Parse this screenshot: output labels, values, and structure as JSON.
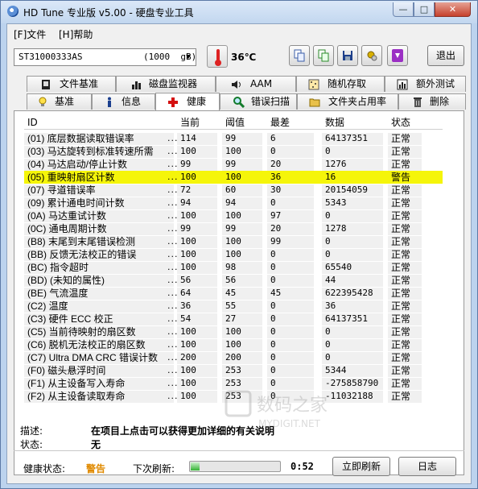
{
  "window": {
    "title": "HD Tune 专业版 v5.00 - 硬盘专业工具"
  },
  "menu": {
    "file": "[F]文件",
    "help": "[H]帮助"
  },
  "toolbar": {
    "drive": "ST31000333AS",
    "drive_size": "(1000  gB)",
    "temperature": "36℃",
    "exit_label": "退出",
    "icons": [
      "copy-icon",
      "copy-text-icon",
      "save-icon",
      "options-icon",
      "download-icon"
    ]
  },
  "tabs_row1": [
    "文件基准",
    "磁盘监视器",
    "AAM",
    "随机存取",
    "额外测试"
  ],
  "tabs_row2": [
    "基准",
    "信息",
    "健康",
    "错误扫描",
    "文件夹占用率",
    "删除"
  ],
  "active_tab": "健康",
  "table": {
    "columns": [
      "ID",
      "当前",
      "阈值",
      "最差",
      "数据",
      "状态"
    ],
    "rows": [
      {
        "id": "(01) 底层数据读取错误率",
        "cur": "114",
        "thr": "99",
        "worst": "6",
        "data": "64137351",
        "status": "正常"
      },
      {
        "id": "(03) 马达旋转到标准转速所需",
        "cur": "100",
        "thr": "100",
        "worst": "0",
        "data": "0",
        "status": "正常"
      },
      {
        "id": "(04) 马达启动/停止计数",
        "cur": "99",
        "thr": "99",
        "worst": "20",
        "data": "1276",
        "status": "正常"
      },
      {
        "id": "(05) 重映射扇区计数",
        "cur": "100",
        "thr": "100",
        "worst": "36",
        "data": "16",
        "status": "警告",
        "warn": true
      },
      {
        "id": "(07) 寻道错误率",
        "cur": "72",
        "thr": "60",
        "worst": "30",
        "data": "20154059",
        "status": "正常"
      },
      {
        "id": "(09) 累计通电时间计数",
        "cur": "94",
        "thr": "94",
        "worst": "0",
        "data": "5343",
        "status": "正常"
      },
      {
        "id": "(0A) 马达重试计数",
        "cur": "100",
        "thr": "100",
        "worst": "97",
        "data": "0",
        "status": "正常"
      },
      {
        "id": "(0C) 通电周期计数",
        "cur": "99",
        "thr": "99",
        "worst": "20",
        "data": "1278",
        "status": "正常"
      },
      {
        "id": "(B8) 末尾到末尾错误检测",
        "cur": "100",
        "thr": "100",
        "worst": "99",
        "data": "0",
        "status": "正常"
      },
      {
        "id": "(BB) 反馈无法校正的错误",
        "cur": "100",
        "thr": "100",
        "worst": "0",
        "data": "0",
        "status": "正常"
      },
      {
        "id": "(BC) 指令超时",
        "cur": "100",
        "thr": "98",
        "worst": "0",
        "data": "65540",
        "status": "正常"
      },
      {
        "id": "(BD) (未知的属性)",
        "cur": "56",
        "thr": "56",
        "worst": "0",
        "data": "44",
        "status": "正常"
      },
      {
        "id": "(BE) 气流温度",
        "cur": "64",
        "thr": "45",
        "worst": "45",
        "data": "622395428",
        "status": "正常"
      },
      {
        "id": "(C2) 温度",
        "cur": "36",
        "thr": "55",
        "worst": "0",
        "data": "36",
        "status": "正常"
      },
      {
        "id": "(C3) 硬件 ECC 校正",
        "cur": "54",
        "thr": "27",
        "worst": "0",
        "data": "64137351",
        "status": "正常"
      },
      {
        "id": "(C5) 当前待映射的扇区数",
        "cur": "100",
        "thr": "100",
        "worst": "0",
        "data": "0",
        "status": "正常"
      },
      {
        "id": "(C6) 脱机无法校正的扇区数",
        "cur": "100",
        "thr": "100",
        "worst": "0",
        "data": "0",
        "status": "正常"
      },
      {
        "id": "(C7) Ultra DMA CRC 错误计数",
        "cur": "200",
        "thr": "200",
        "worst": "0",
        "data": "0",
        "status": "正常"
      },
      {
        "id": "(F0) 磁头悬浮时间",
        "cur": "100",
        "thr": "253",
        "worst": "0",
        "data": "5344",
        "status": "正常"
      },
      {
        "id": "(F1) 从主设备写入寿命",
        "cur": "100",
        "thr": "253",
        "worst": "0",
        "data": "-275858790",
        "status": "正常"
      },
      {
        "id": "(F2) 从主设备读取寿命",
        "cur": "100",
        "thr": "253",
        "worst": "0",
        "data": "-11032188",
        "status": "正常"
      }
    ]
  },
  "detail": {
    "desc_label": "描述:",
    "desc_value": "在项目上点击可以获得更加详细的有关说明",
    "state_label": "状态:",
    "state_value": "无"
  },
  "status": {
    "health_label": "健康状态:",
    "health_value": "警告",
    "refresh_label": "下次刷新:",
    "refresh_progress": 0.1,
    "countdown": "0:52",
    "refresh_button": "立即刷新",
    "log_button": "日志"
  },
  "colors": {
    "warn_row": "#f5f50a",
    "warn_text": "#e08a00"
  }
}
